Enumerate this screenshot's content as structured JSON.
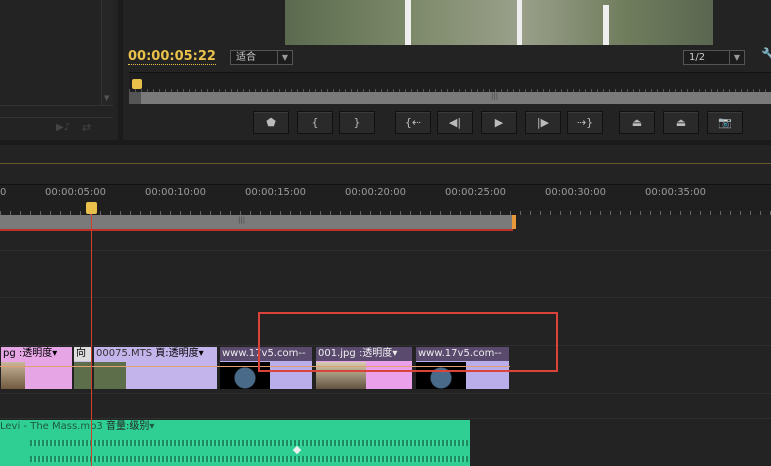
{
  "program_monitor": {
    "timecode": "00:00:05:22",
    "zoom_select": "适合",
    "resolution_select": "1/2",
    "buttons": [
      "add-marker",
      "mark-in",
      "mark-out",
      "go-to-in",
      "step-back",
      "play",
      "step-forward",
      "go-to-out",
      "lift",
      "extract",
      "export-frame"
    ]
  },
  "timeline": {
    "ruler_labels": [
      "0",
      "00:00:05:00",
      "00:00:10:00",
      "00:00:15:00",
      "00:00:20:00",
      "00:00:25:00",
      "00:00:30:00",
      "00:00:35:00"
    ],
    "video_clips": [
      {
        "name": "pg",
        "fx": ":透明度",
        "color": "#e6a6e6"
      },
      {
        "name": "向",
        "fx": "",
        "color": "#c9b7e6"
      },
      {
        "name": "00075.MTS",
        "fx": "頁:透明度",
        "color": "#c3b4ec"
      },
      {
        "name": "www.17v5.com--",
        "fx": "",
        "color": "#b9aeea"
      },
      {
        "name": "001.jpg",
        "fx": ":透明度",
        "color": "#eaa0ea"
      },
      {
        "name": "www.17v5.com--",
        "fx": "",
        "color": "#b9aeea"
      }
    ],
    "audio_clip": {
      "name": "Levi - The Mass.mp3",
      "fx": "音量:级别"
    }
  },
  "colors": {
    "accent": "#e8c04a",
    "playhead": "#d0402c",
    "highlight": "#d9433a",
    "audio": "#2fcf94"
  }
}
